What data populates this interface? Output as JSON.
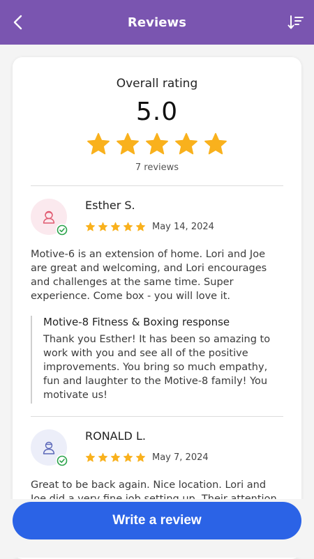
{
  "header": {
    "title": "Reviews",
    "bg_color": "#7a55b0"
  },
  "summary": {
    "label": "Overall rating",
    "value": "5.0",
    "stars": 5,
    "count_text": "7 reviews",
    "star_color": "#f9b11d"
  },
  "reviews": [
    {
      "name": "Esther S.",
      "stars": 5,
      "date": "May 14, 2024",
      "avatar_icon": "female-user-icon",
      "body": "Motive-6 is an extension of home. Lori and Joe are great and welcoming, and Lori encourages and challenges at the same time. Super experience. Come box - you will love it.",
      "response": {
        "title": "Motive-8 Fitness & Boxing response",
        "body": "Thank you Esther! It has been so amazing to work with you and see all of the positive improvements. You bring so much empathy, fun and laughter to the Motive-8 family! You motivate us!"
      }
    },
    {
      "name": "RONALD L.",
      "stars": 5,
      "date": "May 7, 2024",
      "avatar_icon": "male-user-icon",
      "body": "Great to be back again. Nice location. Lori and Joe did a very fine job setting up. Their attention to details"
    }
  ],
  "actions": {
    "write_review_label": "Write a review",
    "button_color": "#2b63e6"
  },
  "icons": {
    "back": "chevron-left-icon",
    "sort": "sort-icon",
    "verified": "check-circle-icon",
    "star": "star-icon"
  }
}
